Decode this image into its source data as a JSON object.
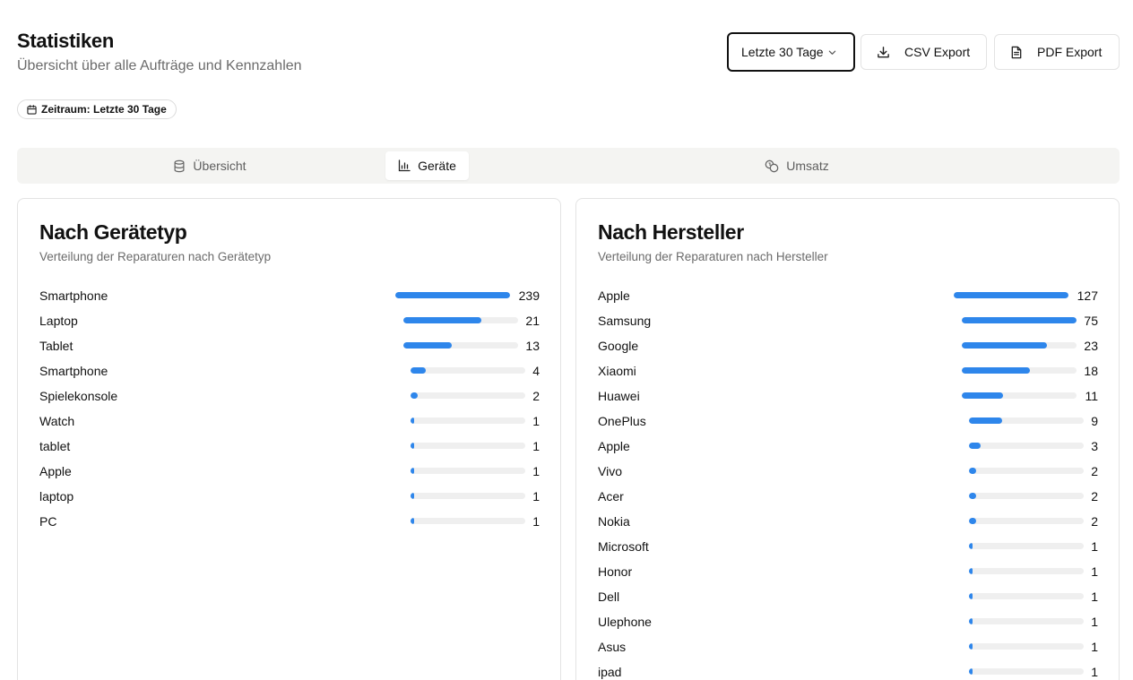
{
  "header": {
    "title": "Statistiken",
    "subtitle": "Übersicht über alle Aufträge und Kennzahlen"
  },
  "toolbar": {
    "range_value": "Letzte 30 Tage",
    "csv_label": "CSV Export",
    "pdf_label": "PDF Export"
  },
  "period_badge": "Zeitraum: Letzte 30 Tage",
  "tabs": [
    {
      "label": "Übersicht",
      "icon": "database-icon",
      "active": false
    },
    {
      "label": "Geräte",
      "icon": "bar-chart-icon",
      "active": true
    },
    {
      "label": "Umsatz",
      "icon": "coins-icon",
      "active": false
    }
  ],
  "colors": {
    "accent": "#2e86eb",
    "track": "#efefef"
  },
  "device_types": {
    "title": "Nach Gerätetyp",
    "description": "Verteilung der Reparaturen nach Gerätetyp",
    "items": [
      {
        "label": "Smartphone",
        "value": "239",
        "share": 1.0
      },
      {
        "label": "Laptop",
        "value": "21",
        "share": 0.68
      },
      {
        "label": "Tablet",
        "value": "13",
        "share": 0.42
      },
      {
        "label": "Smartphone",
        "value": "4",
        "share": 0.13
      },
      {
        "label": "Spielekonsole",
        "value": "2",
        "share": 0.06
      },
      {
        "label": "Watch",
        "value": "1",
        "share": 0.03
      },
      {
        "label": "tablet",
        "value": "1",
        "share": 0.03
      },
      {
        "label": "Apple",
        "value": "1",
        "share": 0.03
      },
      {
        "label": "laptop",
        "value": "1",
        "share": 0.03
      },
      {
        "label": "PC",
        "value": "1",
        "share": 0.03
      }
    ]
  },
  "manufacturers": {
    "title": "Nach Hersteller",
    "description": "Verteilung der Reparaturen nach Hersteller",
    "items": [
      {
        "label": "Apple",
        "value": "127",
        "share": 1.0
      },
      {
        "label": "Samsung",
        "value": "75",
        "share": 1.0
      },
      {
        "label": "Google",
        "value": "23",
        "share": 0.74
      },
      {
        "label": "Xiaomi",
        "value": "18",
        "share": 0.59
      },
      {
        "label": "Huawei",
        "value": "11",
        "share": 0.36
      },
      {
        "label": "OnePlus",
        "value": "9",
        "share": 0.29
      },
      {
        "label": "Apple",
        "value": "3",
        "share": 0.1
      },
      {
        "label": "Vivo",
        "value": "2",
        "share": 0.06
      },
      {
        "label": "Acer",
        "value": "2",
        "share": 0.06
      },
      {
        "label": "Nokia",
        "value": "2",
        "share": 0.06
      },
      {
        "label": "Microsoft",
        "value": "1",
        "share": 0.03
      },
      {
        "label": "Honor",
        "value": "1",
        "share": 0.03
      },
      {
        "label": "Dell",
        "value": "1",
        "share": 0.03
      },
      {
        "label": "Ulephone",
        "value": "1",
        "share": 0.03
      },
      {
        "label": "Asus",
        "value": "1",
        "share": 0.03
      },
      {
        "label": "ipad",
        "value": "1",
        "share": 0.03
      }
    ]
  }
}
